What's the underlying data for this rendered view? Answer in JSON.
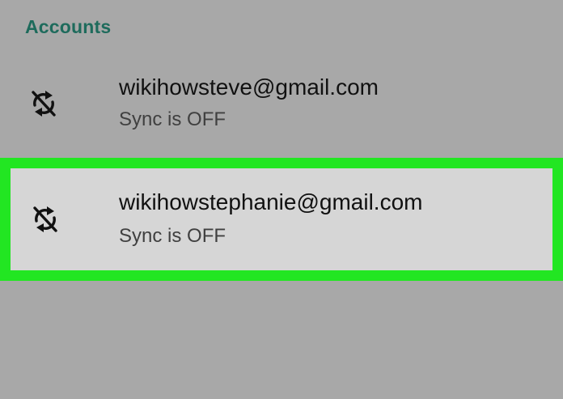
{
  "section": {
    "title": "Accounts"
  },
  "accounts": [
    {
      "email": "wikihowsteve@gmail.com",
      "status": "Sync is OFF",
      "icon": "sync-off-icon",
      "highlighted": false
    },
    {
      "email": "wikihowstephanie@gmail.com",
      "status": "Sync is OFF",
      "icon": "sync-off-icon",
      "highlighted": true
    }
  ],
  "colors": {
    "background": "#a8a8a8",
    "header_text": "#1e6b5c",
    "highlight_border": "#22e622",
    "highlight_fill": "#d6d6d6"
  }
}
